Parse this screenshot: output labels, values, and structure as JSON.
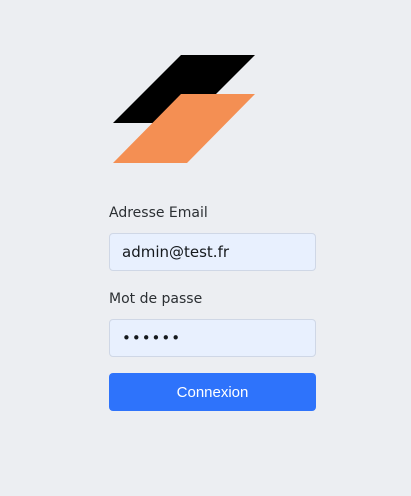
{
  "login_form": {
    "email_label": "Adresse Email",
    "email_value": "admin@test.fr",
    "password_label": "Mot de passe",
    "password_value": "••••••",
    "submit_label": "Connexion"
  },
  "colors": {
    "background": "#eceef2",
    "logo_top": "#000000",
    "logo_bottom": "#f48f53",
    "input_background": "#e8f0fe",
    "primary_button": "#2e73fb"
  },
  "icons": {
    "logo": "layered-parallelogram-logo"
  }
}
